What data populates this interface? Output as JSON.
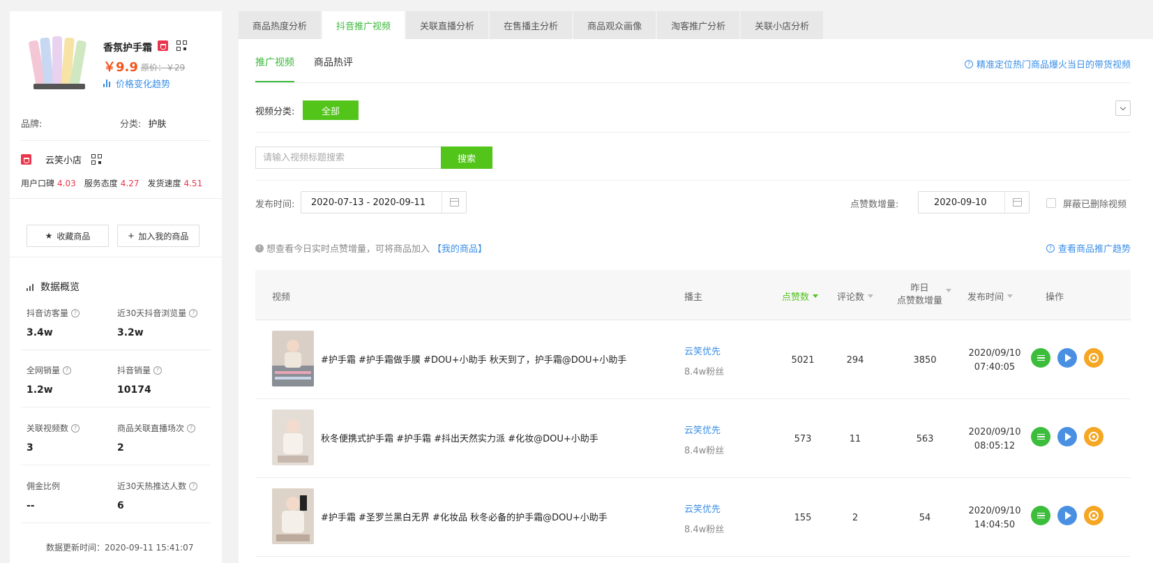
{
  "product": {
    "name": "香氛护手霜",
    "price": "￥9.9",
    "original_price": "原价：￥29",
    "trend_link": "价格变化趋势",
    "brand_label": "品牌:",
    "brand_value": "",
    "category_label": "分类:",
    "category_value": "护肤"
  },
  "shop": {
    "name": "云笑小店",
    "scores": [
      {
        "label": "用户口碑",
        "value": "4.03"
      },
      {
        "label": "服务态度",
        "value": "4.27"
      },
      {
        "label": "发货速度",
        "value": "4.51"
      }
    ]
  },
  "actions": {
    "favorite": "收藏商品",
    "add_mine": "加入我的商品"
  },
  "overview": {
    "title": "数据概览",
    "stats": [
      {
        "label": "抖音访客量",
        "value": "3.4w"
      },
      {
        "label": "近30天抖音浏览量",
        "value": "3.2w"
      },
      {
        "label": "全网销量",
        "value": "1.2w"
      },
      {
        "label": "抖音销量",
        "value": "10174"
      },
      {
        "label": "关联视频数",
        "value": "3"
      },
      {
        "label": "商品关联直播场次",
        "value": "2"
      },
      {
        "label": "佣金比例",
        "value": "--"
      },
      {
        "label": "近30天热推达人数",
        "value": "6"
      }
    ],
    "update_time": "数据更新时间：2020-09-11 15:41:07"
  },
  "tabs": [
    "商品热度分析",
    "抖音推广视频",
    "关联直播分析",
    "在售播主分析",
    "商品观众画像",
    "淘客推广分析",
    "关联小店分析"
  ],
  "active_tab": 1,
  "subtabs": [
    "推广视频",
    "商品热评"
  ],
  "help_link": "精准定位热门商品爆火当日的带货视频",
  "filters": {
    "category_label": "视频分类:",
    "category_all": "全部",
    "search_placeholder": "请输入视频标题搜索",
    "search_button": "搜索",
    "publish_label": "发布时间:",
    "publish_range": "2020-07-13 - 2020-09-11",
    "likes_label": "点赞数增量:",
    "likes_date": "2020-09-10",
    "hide_deleted": "屏蔽已删除视频"
  },
  "notice": {
    "text": "想查看今日实时点赞增量，可将商品加入",
    "link": "【我的商品】",
    "trend_link": "查看商品推广趋势"
  },
  "table": {
    "headers": {
      "video": "视频",
      "author": "播主",
      "likes": "点赞数",
      "comments": "评论数",
      "yesterday_line1": "昨日",
      "yesterday_line2": "点赞数增量",
      "publish": "发布时间",
      "ops": "操作"
    },
    "rows": [
      {
        "title": "#护手霜 #护手霜做手膜 #DOU+小助手 秋天到了，护手霜@DOU+小助手",
        "author": "云笑优先",
        "fans": "8.4w粉丝",
        "likes": "5021",
        "comments": "294",
        "yesterday": "3850",
        "date": "2020/09/10",
        "time": "07:40:05"
      },
      {
        "title": "秋冬便携式护手霜 #护手霜 #抖出天然实力派 #化妆@DOU+小助手",
        "author": "云笑优先",
        "fans": "8.4w粉丝",
        "likes": "573",
        "comments": "11",
        "yesterday": "563",
        "date": "2020/09/10",
        "time": "08:05:12"
      },
      {
        "title": "#护手霜 #圣罗兰黑白无界 #化妆品 秋冬必备的护手霜@DOU+小助手",
        "author": "云笑优先",
        "fans": "8.4w粉丝",
        "likes": "155",
        "comments": "2",
        "yesterday": "54",
        "date": "2020/09/10",
        "time": "14:04:50"
      }
    ]
  },
  "colors": {
    "accent_green": "#52c41a",
    "link_blue": "#3a8ee6",
    "price_orange": "#f2541b",
    "score_red": "#e9364c"
  }
}
